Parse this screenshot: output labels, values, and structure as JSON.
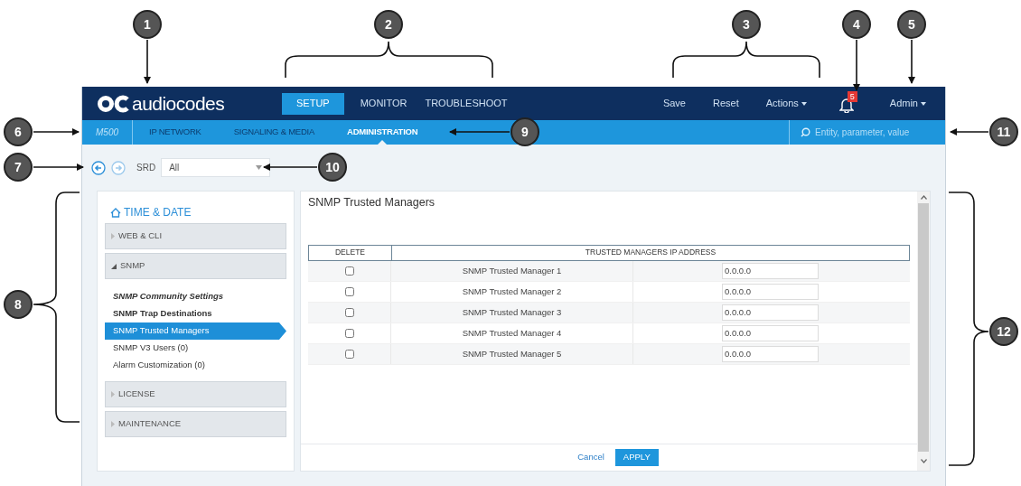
{
  "callouts": [
    "1",
    "2",
    "3",
    "4",
    "5",
    "6",
    "7",
    "8",
    "9",
    "10",
    "11",
    "12"
  ],
  "top_bar": {
    "logo": "audiocodes",
    "tabs": [
      {
        "label": "SETUP",
        "selected": true
      },
      {
        "label": "MONITOR",
        "selected": false
      },
      {
        "label": "TROUBLESHOOT",
        "selected": false
      }
    ],
    "actions": [
      {
        "kind": "link",
        "label": "Save"
      },
      {
        "kind": "link",
        "label": "Reset"
      },
      {
        "kind": "menu",
        "label": "Actions"
      },
      {
        "kind": "bell",
        "badge": "5"
      },
      {
        "kind": "menu",
        "label": "Admin"
      }
    ]
  },
  "sub_bar": {
    "device": "M500",
    "items": [
      {
        "label": "IP NETWORK",
        "selected": false
      },
      {
        "label": "SIGNALING & MEDIA",
        "selected": false
      },
      {
        "label": "ADMINISTRATION",
        "selected": true
      }
    ],
    "search": {
      "placeholder": "Entity, parameter, value"
    }
  },
  "toolbar": {
    "srd_label": "SRD",
    "srd_value": "All"
  },
  "sidebar": {
    "title": "TIME & DATE",
    "groups": [
      {
        "label": "WEB & CLI",
        "expanded": false
      },
      {
        "label": "SNMP",
        "expanded": true,
        "children": [
          {
            "label": "SNMP Community Settings",
            "kind": "bold-italic",
            "selected": false
          },
          {
            "label": "SNMP Trap Destinations",
            "kind": "bold",
            "selected": false
          },
          {
            "label": "SNMP Trusted Managers",
            "kind": "normal",
            "selected": true
          },
          {
            "label": "SNMP V3 Users (0)",
            "kind": "normal",
            "selected": false
          },
          {
            "label": "Alarm Customization (0)",
            "kind": "normal",
            "selected": false
          }
        ]
      },
      {
        "label": "LICENSE",
        "expanded": false
      },
      {
        "label": "MAINTENANCE",
        "expanded": false
      }
    ]
  },
  "content": {
    "title": "SNMP Trusted Managers",
    "columns": [
      "DELETE",
      "TRUSTED MANAGERS IP ADDRESS"
    ],
    "rows": [
      {
        "delete": false,
        "name": "SNMP Trusted Manager 1",
        "address": "0.0.0.0"
      },
      {
        "delete": false,
        "name": "SNMP Trusted Manager 2",
        "address": "0.0.0.0"
      },
      {
        "delete": false,
        "name": "SNMP Trusted Manager 3",
        "address": "0.0.0.0"
      },
      {
        "delete": false,
        "name": "SNMP Trusted Manager 4",
        "address": "0.0.0.0"
      },
      {
        "delete": false,
        "name": "SNMP Trusted Manager 5",
        "address": "0.0.0.0"
      }
    ],
    "buttons": [
      {
        "kind": "link",
        "label": "Cancel"
      },
      {
        "kind": "primary",
        "label": "APPLY"
      }
    ]
  }
}
